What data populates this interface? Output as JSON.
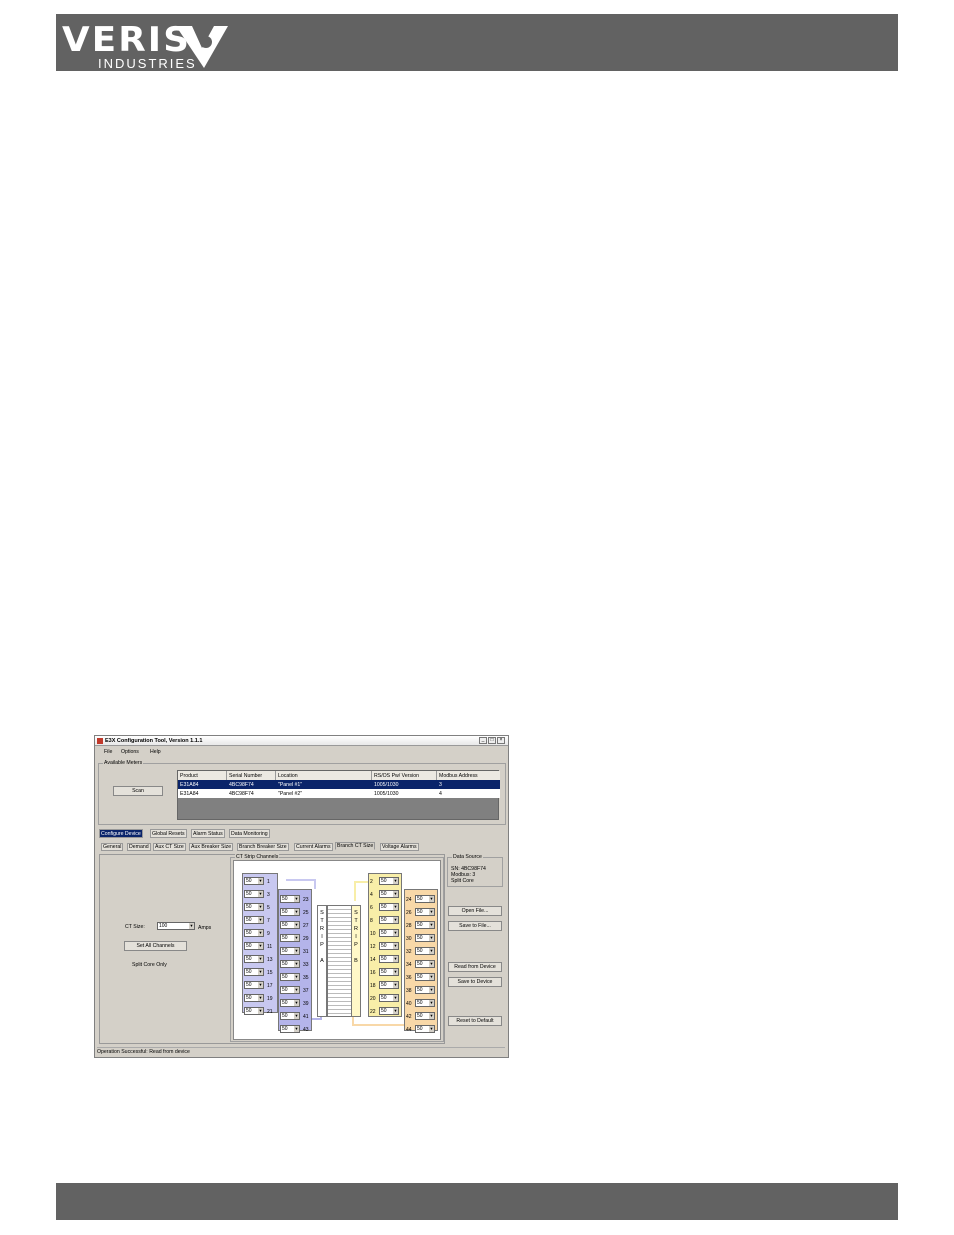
{
  "logo": {
    "main": "VERIS",
    "sub": "INDUSTRIES"
  },
  "window": {
    "title": "E3X Configuration Tool, Version 1.1.1",
    "menu": [
      "File",
      "Options",
      "Help"
    ],
    "available_meters_label": "Available Meters",
    "scan_label": "Scan",
    "table": {
      "headers": [
        "Product",
        "Serial Number",
        "Location",
        "RS/OS Pw/ Version",
        "Modbus Address"
      ],
      "rows": [
        [
          "E31A84",
          "4BC98F74",
          "\"Panel #1\"",
          "1005/1030",
          "3"
        ],
        [
          "E31A84",
          "4BC98F74",
          "\"Panel #2\"",
          "1005/1030",
          "4"
        ]
      ]
    },
    "main_tabs": [
      "Configure Device",
      "Global Resets",
      "Alarm Status",
      "Data Monitoring"
    ],
    "sub_tabs": [
      "General",
      "Demand",
      "Aux CT Size",
      "Aux Breaker Size",
      "Branch Breaker Size",
      "Current Alarms",
      "Branch CT Size",
      "Voltage Alarms"
    ],
    "left": {
      "ct_size_label": "CT Size:",
      "ct_size_value": "100",
      "ct_size_unit": "Amps",
      "set_all_label": "Set All Channels",
      "split_core_label": "Split Core Only"
    },
    "ct_strip_label": "CT Strip Channels",
    "ct_default_value": "50",
    "strip_a_letters": [
      "S",
      "T",
      "R",
      "I",
      "P",
      "",
      "A"
    ],
    "strip_b_letters": [
      "S",
      "T",
      "R",
      "I",
      "P",
      "",
      "B"
    ],
    "data_source": {
      "label": "Data Source",
      "sn": "SN: 4BC98F74",
      "modbus": "Modbus: 3",
      "core": "Split Core"
    },
    "buttons": {
      "open": "Open File...",
      "save_file": "Save to File...",
      "read": "Read from Device",
      "save_device": "Save to Device",
      "reset": "Reset to Default"
    },
    "status": "Operation Successful: Read from device"
  },
  "colors": {
    "bar": "#626262",
    "strip_a1": "#c8c8f0",
    "strip_a2": "#b4b4ea",
    "strip_b1": "#f8eea8",
    "strip_b2": "#f8d8a8",
    "selection": "#0a246a"
  }
}
